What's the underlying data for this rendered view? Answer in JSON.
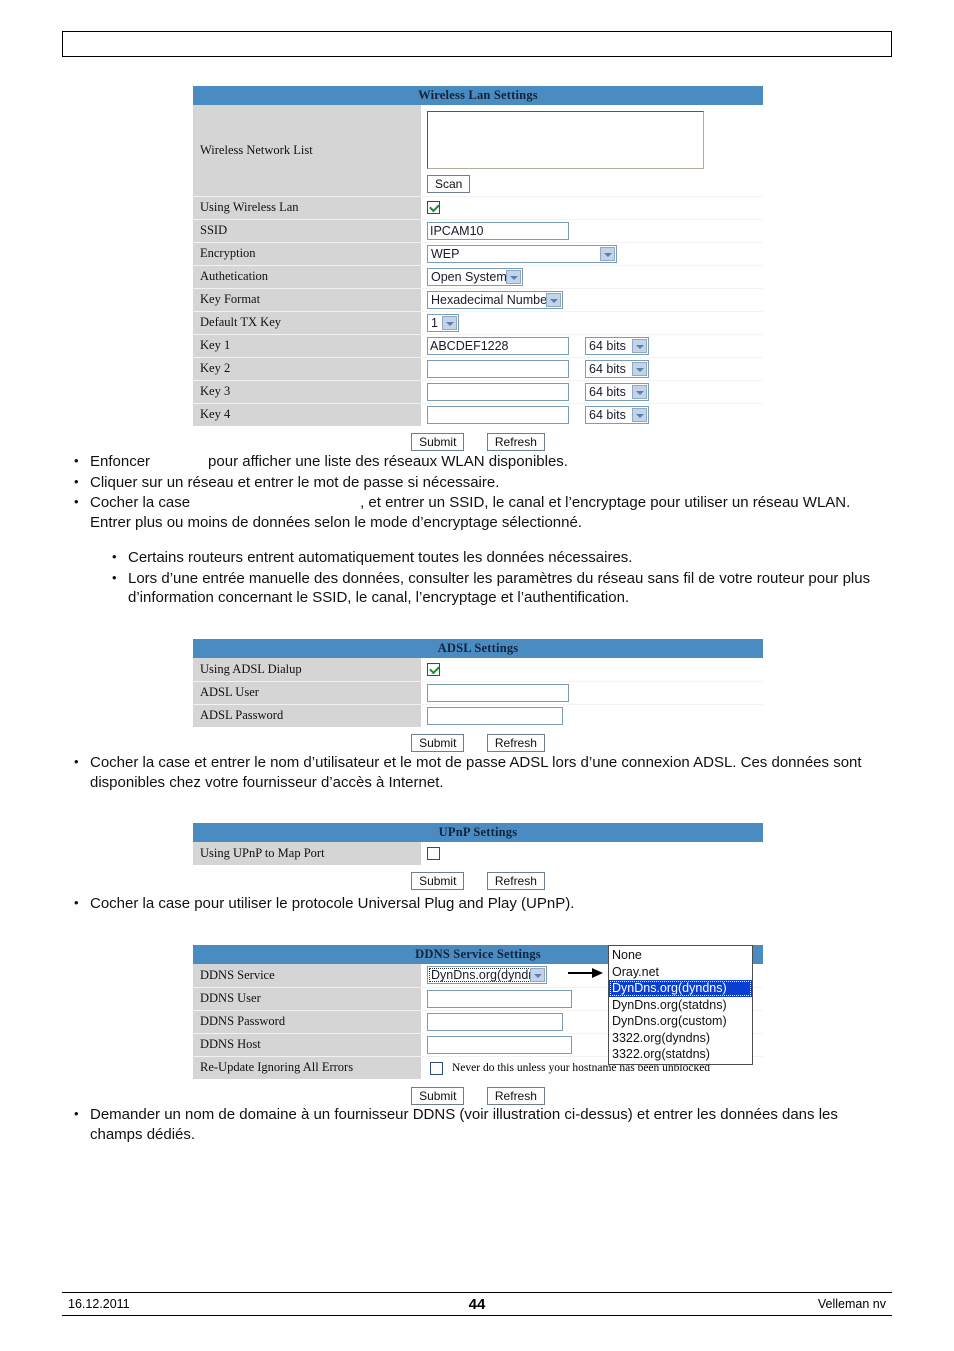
{
  "page": {
    "header_box_text": "",
    "footer": {
      "date": "16.12.2011",
      "page_number": "44",
      "company": "Velleman nv"
    }
  },
  "wireless_table": {
    "title": "Wireless Lan Settings",
    "rows": {
      "network_list_label": "Wireless Network List",
      "scan_button": "Scan",
      "using_wireless_label": "Using Wireless Lan",
      "using_wireless_checked": true,
      "ssid_label": "SSID",
      "ssid_value": "IPCAM10",
      "encryption_label": "Encryption",
      "encryption_value": "WEP",
      "authetication_label": "Authetication",
      "authetication_value": "Open System",
      "key_format_label": "Key Format",
      "key_format_value": "Hexadecimal Number",
      "default_tx_key_label": "Default TX Key",
      "default_tx_key_value": "1",
      "key1_label": "Key 1",
      "key1_value": "ABCDEF1228",
      "key1_bits": "64 bits",
      "key2_label": "Key 2",
      "key2_value": "",
      "key2_bits": "64 bits",
      "key3_label": "Key 3",
      "key3_value": "",
      "key3_bits": "64 bits",
      "key4_label": "Key 4",
      "key4_value": "",
      "key4_bits": "64 bits"
    },
    "submit_button": "Submit",
    "refresh_button": "Refresh"
  },
  "wireless_bullets": {
    "b1_a": "Enfoncer",
    "b1_b": "pour afficher une liste des réseaux WLAN disponibles.",
    "b2": "Cliquer sur un réseau et entrer le mot de passe si nécessaire.",
    "b3_a": "Cocher la case",
    "b3_b": ", et entrer un SSID, le canal et l’encryptage pour utiliser un réseau WLAN. Entrer plus ou moins de données selon le mode d’encryptage sélectionné."
  },
  "wireless_sub_bullets": {
    "s1": "Certains routeurs entrent automatiquement toutes les données nécessaires.",
    "s2": "Lors d’une entrée manuelle des données, consulter les paramètres du réseau sans fil de votre routeur pour plus d’information concernant le SSID, le canal, l’encryptage et l’authentification."
  },
  "adsl_table": {
    "title": "ADSL Settings",
    "rows": {
      "using_adsl_label": "Using ADSL Dialup",
      "using_adsl_checked": true,
      "adsl_user_label": "ADSL User",
      "adsl_user_value": "",
      "adsl_password_label": "ADSL Password",
      "adsl_password_value": ""
    },
    "submit_button": "Submit",
    "refresh_button": "Refresh"
  },
  "adsl_bullets": {
    "b1": "Cocher la case et entrer le nom d’utilisateur et le mot de passe ADSL lors d’une connexion ADSL. Ces données sont disponibles chez votre fournisseur d’accès à Internet."
  },
  "upnp_table": {
    "title": "UPnP Settings",
    "rows": {
      "using_upnp_label": "Using UPnP to Map Port",
      "using_upnp_checked": false
    },
    "submit_button": "Submit",
    "refresh_button": "Refresh"
  },
  "upnp_bullets": {
    "b1": "Cocher la case pour utiliser le protocole Universal Plug and Play (UPnP)."
  },
  "ddns_table": {
    "title": "DDNS Service Settings",
    "rows": {
      "ddns_service_label": "DDNS Service",
      "ddns_service_value": "DynDns.org(dyndns)",
      "ddns_user_label": "DDNS User",
      "ddns_user_value": "",
      "ddns_password_label": "DDNS Password",
      "ddns_password_value": "",
      "ddns_host_label": "DDNS Host",
      "ddns_host_value": "",
      "reupdate_label": "Re-Update Ignoring All Errors",
      "reupdate_checked": false,
      "reupdate_note": "Never do this unless your hostname has been unblocked"
    },
    "submit_button": "Submit",
    "refresh_button": "Refresh",
    "dropdown_options": [
      {
        "label": "None",
        "selected": false
      },
      {
        "label": "Oray.net",
        "selected": false
      },
      {
        "label": "DynDns.org(dyndns)",
        "selected": true
      },
      {
        "label": "DynDns.org(statdns)",
        "selected": false
      },
      {
        "label": "DynDns.org(custom)",
        "selected": false
      },
      {
        "label": "3322.org(dyndns)",
        "selected": false
      },
      {
        "label": "3322.org(statdns)",
        "selected": false
      }
    ]
  },
  "ddns_bullets": {
    "b1": "Demander un nom de domaine à un fournisseur DDNS (voir illustration ci-dessus) et entrer les données dans les champs dédiés."
  },
  "colors": {
    "table_header_blue": "#4a8cc2",
    "label_gray": "#d5d5d5",
    "dropdown_highlight": "#0a3fd1"
  }
}
